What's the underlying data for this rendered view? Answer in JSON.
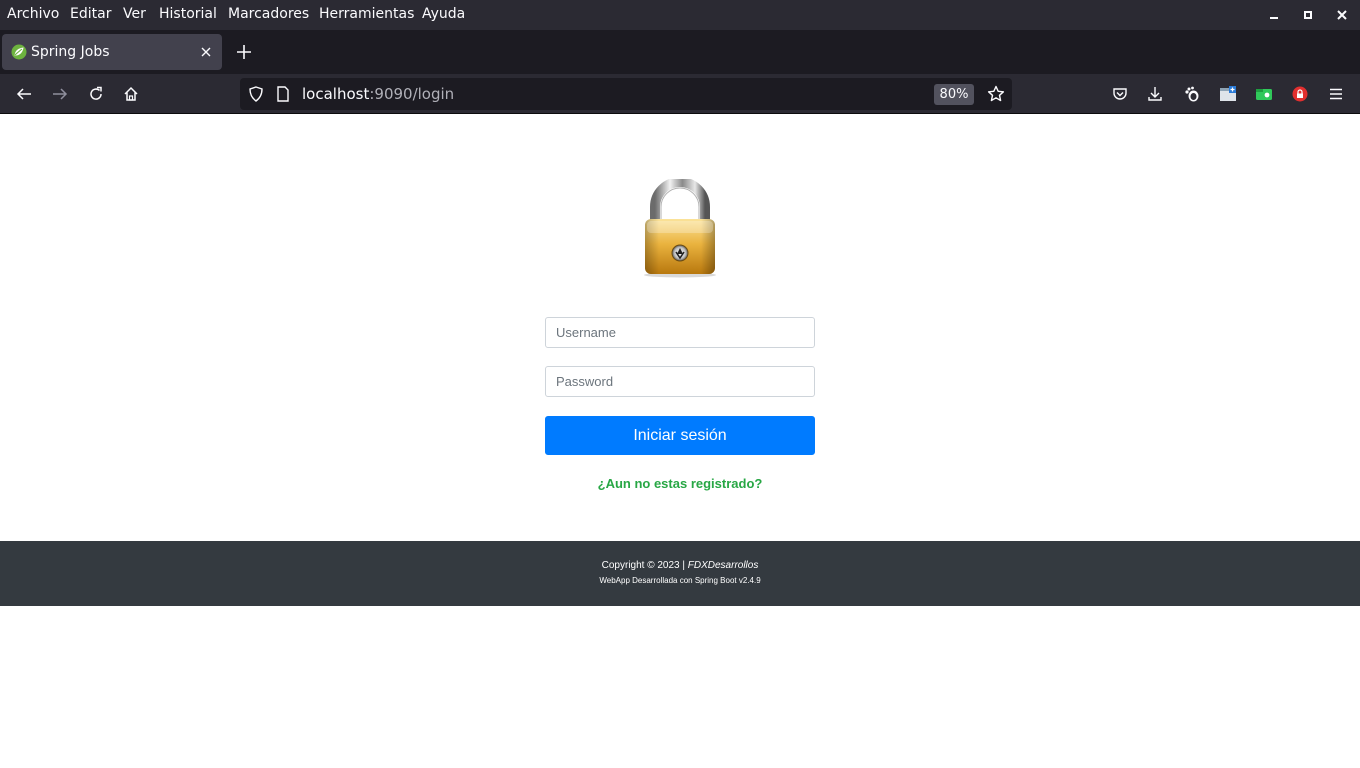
{
  "menubar": {
    "items": [
      {
        "label": "Archivo"
      },
      {
        "label": "Editar"
      },
      {
        "label": "Ver"
      },
      {
        "label": "Historial"
      },
      {
        "label": "Marcadores"
      },
      {
        "label": "Herramientas"
      },
      {
        "label": "Ayuda"
      }
    ]
  },
  "tab": {
    "title": "Spring Jobs"
  },
  "urlbar": {
    "host": "localhost",
    "rest": ":9090/login",
    "zoom": "80%"
  },
  "login": {
    "username_placeholder": "Username",
    "password_placeholder": "Password",
    "submit_label": "Iniciar sesión",
    "register_link": "¿Aun no estas registrado?"
  },
  "footer": {
    "copyright": "Copyright © 2023 | ",
    "brand": "FDXDesarrollos",
    "credit": "WebApp Desarrollada con Spring Boot v2.4.9"
  },
  "colors": {
    "primary": "#007bff",
    "success": "#28a745",
    "footer_bg": "#343a40",
    "chrome_bg": "#2b2a33"
  }
}
